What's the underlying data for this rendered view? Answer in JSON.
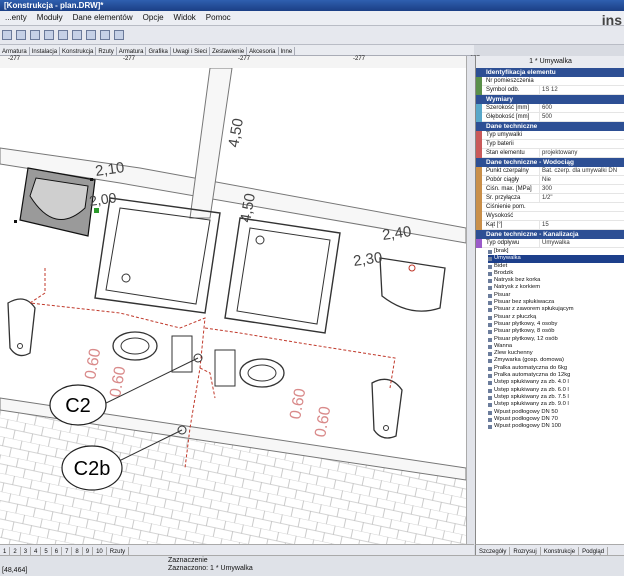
{
  "window": {
    "title": "[Konstrukcja - plan.DRW]*"
  },
  "menu": [
    "...enty",
    "Moduły",
    "Dane elementów",
    "Opcje",
    "Widok",
    "Pomoc"
  ],
  "logo": {
    "text": "ins"
  },
  "toolbar_icons": [
    "new-icon",
    "open-icon",
    "save-icon",
    "print-icon",
    "copy-icon",
    "paste-icon",
    "grid-icon",
    "layers-icon",
    "settings-icon"
  ],
  "layout_tabs": [
    "Armatura",
    "Instalacja",
    "Konstrukcja",
    "Rzuty",
    "Armatura",
    "Grafika",
    "Uwagi i Sieci",
    "Zestawienie",
    "Akcesoria",
    "Inne"
  ],
  "ruler": {
    "labels": [
      "-277",
      "-277",
      "-277",
      "-277",
      "-277"
    ]
  },
  "drawing": {
    "dimensions": [
      "2,10",
      "2,00",
      "4,50",
      "4,50",
      "2,40",
      "2,30",
      "0.60",
      "0.60",
      "0.60",
      "0.60"
    ],
    "callouts": [
      "C2",
      "C2b"
    ]
  },
  "panel": {
    "title": "1 * Umywalka",
    "sections": [
      {
        "title": "Identyfikacja elementu",
        "rows": [
          {
            "k": "Nr pomieszczenia",
            "v": ""
          },
          {
            "k": "Symbol odb.",
            "v": "1S 12"
          }
        ]
      },
      {
        "title": "Wymiary",
        "rows": [
          {
            "k": "Szerokość [mm]",
            "v": "600"
          },
          {
            "k": "Głębokość [mm]",
            "v": "500"
          }
        ]
      },
      {
        "title": "Dane techniczne",
        "rows": [
          {
            "k": "Typ umywalki",
            "v": ""
          },
          {
            "k": "Typ baterii",
            "v": ""
          },
          {
            "k": "Stan elementu",
            "v": "projektowany"
          }
        ]
      },
      {
        "title": "Dane techniczne - Wodociąg",
        "rows": [
          {
            "k": "Punkt czerpalny",
            "v": "Bat. czerp. dla umywalki DN"
          },
          {
            "k": "Pobór ciągły",
            "v": "Nie"
          },
          {
            "k": "Ciśn. max. [MPa]",
            "v": "300"
          },
          {
            "k": "Śr. przyłącza",
            "v": "1/2\""
          },
          {
            "k": "Ciśnienie pom.",
            "v": ""
          },
          {
            "k": "Wysokość",
            "v": ""
          },
          {
            "k": "Kąt [°]",
            "v": "15"
          }
        ]
      },
      {
        "title": "Dane techniczne - Kanalizacja",
        "rows": [
          {
            "k": "Typ odpływu",
            "v": "Umywalka"
          }
        ]
      }
    ],
    "list": [
      "[brak]",
      "Umywalka",
      "Bidet",
      "Brodzik",
      "Natrysk bez korka",
      "Natrysk z korkiem",
      "Pisuar",
      "Pisuar bez spłukiwacza",
      "Pisuar z zaworem spłukującym",
      "Pisuar z płuczką",
      "Pisuar płytkowy, 4 osoby",
      "Pisuar płytkowy, 8 osób",
      "Pisuar płytkowy, 12 osób",
      "Wanna",
      "Zlew kuchenny",
      "Zmywarka (gosp. domowa)",
      "Pralka automatyczna do 6kg",
      "Pralka automatyczna do 12kg",
      "Ustęp spłukiwany za zb. 4.0 l",
      "Ustęp spłukiwany za zb. 6.0 l",
      "Ustęp spłukiwany za zb. 7.5 l",
      "Ustęp spłukiwany za zb. 9.0 l",
      "Wpust podłogowy DN 50",
      "Wpust podłogowy DN 70",
      "Wpust podłogowy DN 100"
    ],
    "selected_index": 1,
    "bottom_tabs": [
      "Szczegóły",
      "Rozrysuj",
      "Konstrukcje",
      "Podgląd"
    ]
  },
  "bottom_tabs": [
    "1",
    "2",
    "3",
    "4",
    "5",
    "6",
    "7",
    "8",
    "9",
    "10",
    "Rzuty"
  ],
  "status": {
    "line1": "Zaznaczenie",
    "line2": "Zaznaczono: 1 * Umywalka",
    "coords": "[48,464]"
  },
  "colors": {
    "accent": "#2d4f94",
    "dim_red": "#c0392b"
  }
}
